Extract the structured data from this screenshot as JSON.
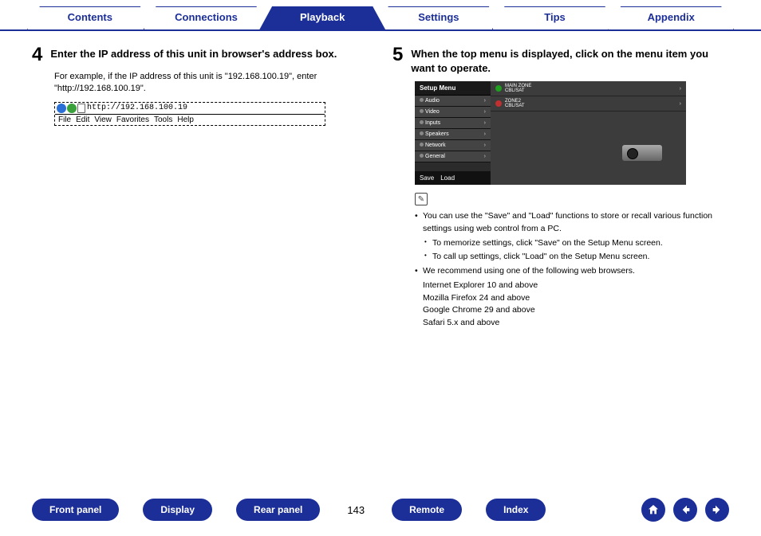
{
  "tabs": {
    "items": [
      "Contents",
      "Connections",
      "Playback",
      "Settings",
      "Tips",
      "Appendix"
    ],
    "active_index": 2
  },
  "left": {
    "step_num": "4",
    "step_title": "Enter the IP address of this unit in browser's address box.",
    "step_desc": "For example, if the IP address of this unit is \"192.168.100.19\", enter \"http://192.168.100.19\".",
    "browser": {
      "address": "http://192.168.100.19",
      "menu": [
        "File",
        "Edit",
        "View",
        "Favorites",
        "Tools",
        "Help"
      ]
    }
  },
  "right": {
    "step_num": "5",
    "step_title": "When the top menu is displayed, click on the menu item you want to operate.",
    "setup": {
      "title": "Setup Menu",
      "items": [
        "Audio",
        "Video",
        "Inputs",
        "Speakers",
        "Network",
        "General"
      ],
      "buttons": [
        "Save",
        "Load"
      ],
      "zones": [
        {
          "label": "MAIN ZONE",
          "sub": "CBL/SAT",
          "state": "green"
        },
        {
          "label": "ZONE2",
          "sub": "CBL/SAT",
          "state": "red"
        }
      ]
    },
    "notes": {
      "b0a": "You can use the \"Save\" and \"Load\" functions to store or recall various function settings using web control from a PC.",
      "b1a": "To memorize settings, click \"Save\" on the Setup Menu screen.",
      "b1b": "To call up settings, click \"Load\" on the Setup Menu screen.",
      "b0b": "We recommend using one of the following web browsers.",
      "browsers": [
        "Internet Explorer 10 and above",
        "Mozilla Firefox 24 and above",
        "Google Chrome 29 and above",
        "Safari 5.x and above"
      ]
    }
  },
  "bottom": {
    "pills": [
      "Front panel",
      "Display",
      "Rear panel"
    ],
    "page": "143",
    "pills2": [
      "Remote",
      "Index"
    ]
  }
}
